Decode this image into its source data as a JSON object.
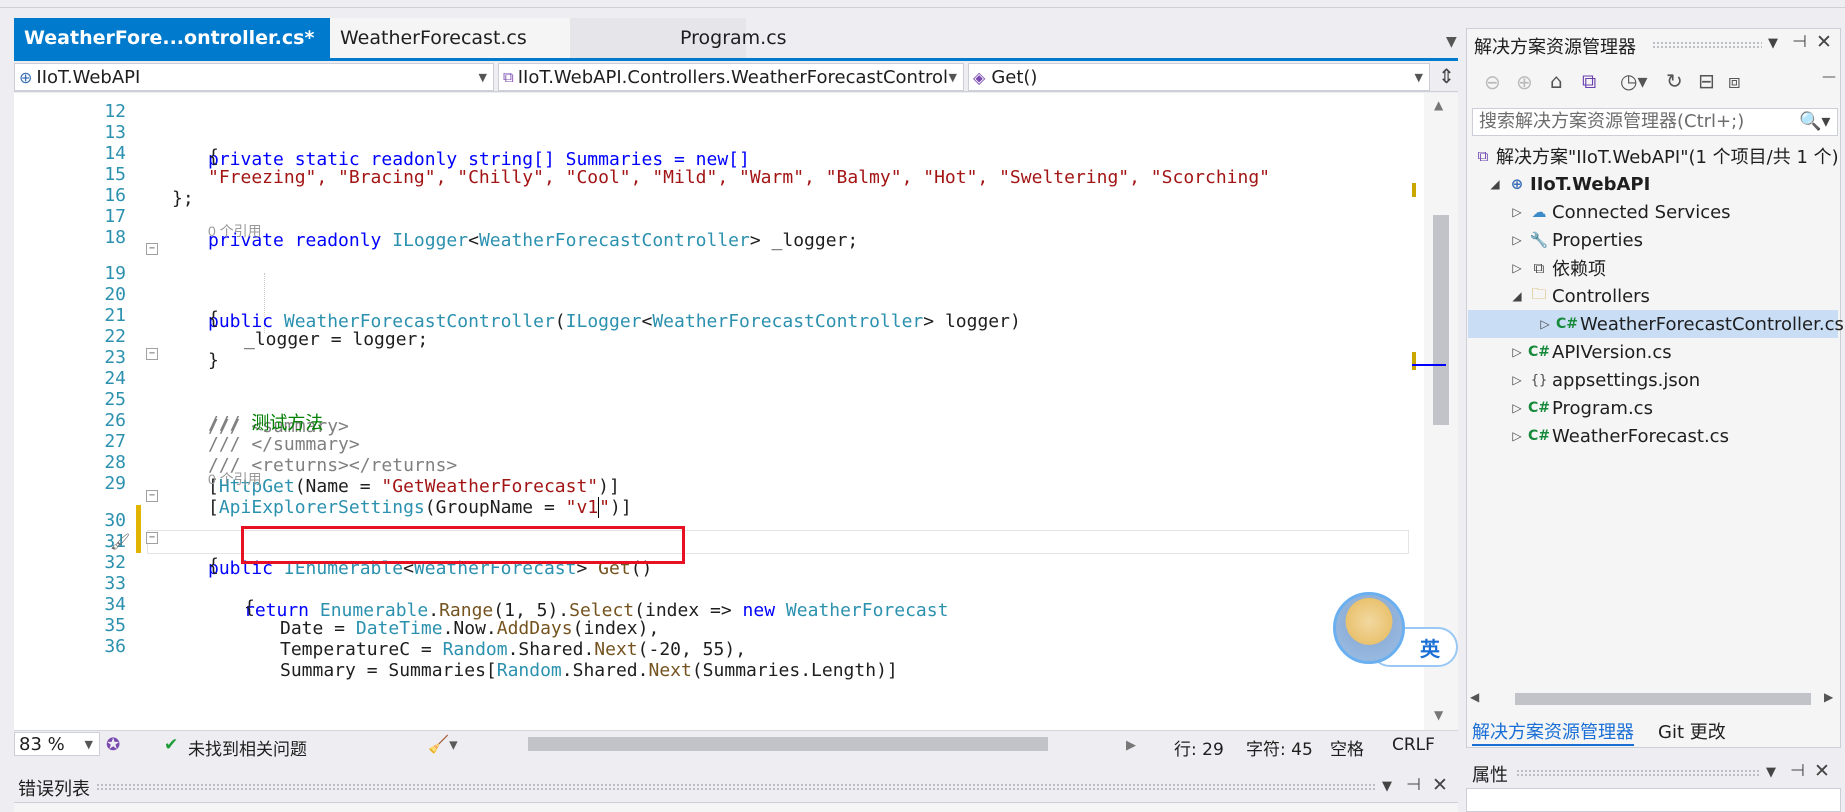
{
  "tabs": [
    {
      "label": "WeatherFore...ontroller.cs*",
      "active": true,
      "pin": "⊣",
      "close": "✕"
    },
    {
      "label": "WeatherForecast.cs"
    },
    {
      "label": "Program.cs"
    }
  ],
  "navbar": {
    "project": "IIoT.WebAPI",
    "class": "IIoT.WebAPI.Controllers.WeatherForecastControl",
    "member": "Get()"
  },
  "editor": {
    "codelens": "0 个引用",
    "codelens2": "0 个引用",
    "zoom": "83 %",
    "status_ok": "未找到相关问题",
    "line": "行: 29",
    "col": "字符: 45",
    "spaces": "空格",
    "eol": "CRLF"
  },
  "code_lines": [
    {
      "n": "12"
    },
    {
      "n": "13"
    },
    {
      "n": "14"
    },
    {
      "n": "15"
    },
    {
      "n": "16"
    },
    {
      "n": "17"
    },
    {
      "n": "18"
    },
    {
      "n": "19"
    },
    {
      "n": "20"
    },
    {
      "n": "21"
    },
    {
      "n": "22"
    },
    {
      "n": "23"
    },
    {
      "n": "24"
    },
    {
      "n": "25"
    },
    {
      "n": "26"
    },
    {
      "n": "27"
    },
    {
      "n": "28"
    },
    {
      "n": "29"
    },
    {
      "n": "30"
    },
    {
      "n": "31"
    },
    {
      "n": "32"
    },
    {
      "n": "33"
    },
    {
      "n": "34"
    },
    {
      "n": "35"
    },
    {
      "n": "36"
    }
  ],
  "code": {
    "l12": "private static readonly string[] Summaries = new[]",
    "l13": "{",
    "l14": "\"Freezing\", \"Bracing\", \"Chilly\", \"Cool\", \"Mild\", \"Warm\", \"Balmy\", \"Hot\", \"Sweltering\", \"Scorching\"",
    "l15": "};",
    "l17a": "private readonly ",
    "l17b": "ILogger",
    "l17c": "<",
    "l17d": "WeatherForecastController",
    "l17e": "> _logger;",
    "l19a": "public ",
    "l19b": "WeatherForecastController",
    "l19c": "(",
    "l19d": "ILogger",
    "l19e": "<",
    "l19f": "WeatherForecastController",
    "l19g": "> logger)",
    "l20": "{",
    "l21": "_logger = logger;",
    "l22": "}",
    "l24a": "/// <summary>",
    "l25a": "/// ",
    "l25b": "测试方法",
    "l26a": "/// </summary>",
    "l27a": "/// <returns></returns>",
    "l28a": "[",
    "l28b": "HttpGet",
    "l28c": "(Name = ",
    "l28d": "\"GetWeatherForecast\"",
    "l28e": ")]",
    "l29a": "[",
    "l29b": "ApiExplorerSettings",
    "l29c": "(GroupName = ",
    "l29d": "\"v1",
    "l29e": "\"",
    "l29f": ")]",
    "l30a": "public ",
    "l30b": "IEnumerable",
    "l30c": "<",
    "l30d": "WeatherForecast",
    "l30e": "> ",
    "l30f": "Get",
    "l30g": "()",
    "l31": "{",
    "l32a": "return ",
    "l32b": "Enumerable",
    "l32c": ".",
    "l32d": "Range",
    "l32e": "(1, 5).",
    "l32f": "Select",
    "l32g": "(index => ",
    "l32h": "new ",
    "l32i": "WeatherForecast",
    "l33": "{",
    "l34a": "Date = ",
    "l34b": "DateTime",
    "l34c": ".Now.",
    "l34d": "AddDays",
    "l34e": "(index),",
    "l35a": "TemperatureC = ",
    "l35b": "Random",
    "l35c": ".Shared.",
    "l35d": "Next",
    "l35e": "(-20, 55),",
    "l36a": "Summary = Summaries[",
    "l36b": "Random",
    "l36c": ".Shared.",
    "l36d": "Next",
    "l36e": "(Summaries.Length)]"
  },
  "ime": {
    "label": "英"
  },
  "error_list": {
    "title": "错误列表"
  },
  "solution_explorer": {
    "title": "解决方案资源管理器",
    "search_placeholder": "搜索解决方案资源管理器(Ctrl+;)",
    "solution": "解决方案\"IIoT.WebAPI\"(1 个项目/共 1 个)",
    "project": "IIoT.WebAPI",
    "items": {
      "connected": "Connected Services",
      "properties": "Properties",
      "deps": "依赖项",
      "controllers": "Controllers",
      "controller_file": "WeatherForecastController.cs",
      "apiversion": "APIVersion.cs",
      "appsettings": "appsettings.json",
      "program": "Program.cs",
      "weatherforecast": "WeatherForecast.cs"
    },
    "tab_active": "解决方案资源管理器",
    "tab_git": "Git 更改"
  },
  "properties": {
    "title": "属性"
  },
  "colors": {
    "accent": "#007acc",
    "highlight": "#e81123",
    "selection": "#c9def5"
  }
}
